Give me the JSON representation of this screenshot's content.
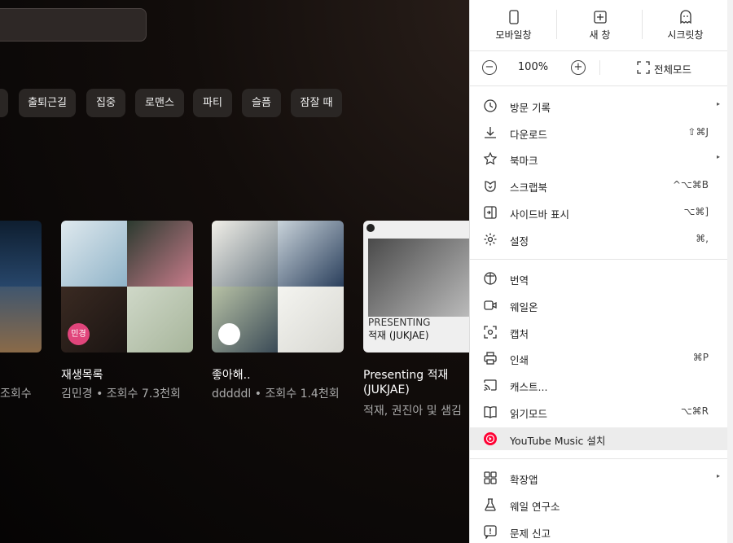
{
  "chips": [
    "출퇴근길",
    "집중",
    "로맨스",
    "파티",
    "슬픔",
    "잠잘 때"
  ],
  "cards": [
    {
      "title": "",
      "subtitle": "조회수"
    },
    {
      "title": "재생목록",
      "subtitle": "김민경 • 조회수 7.3천회",
      "badge": "민경"
    },
    {
      "title": "좋아해..",
      "subtitle": "dddddl • 조회수 1.4천회"
    },
    {
      "title_line1": "Presenting 적재",
      "title_line2": "(JUKJAE)",
      "subtitle": "적재, 권진아 및 샘김",
      "cover_line1": "PRESENTING",
      "cover_line2": "적재 (JUKJAE)"
    }
  ],
  "menu": {
    "top_buttons": [
      {
        "label": "모바일창",
        "icon": "mobile-icon"
      },
      {
        "label": "새 창",
        "icon": "new-window-icon"
      },
      {
        "label": "시크릿창",
        "icon": "incognito-icon"
      }
    ],
    "zoom": {
      "minus": "−",
      "value": "100%",
      "plus": "+",
      "fullscreen": "전체모드"
    },
    "items": [
      {
        "label": "방문 기록",
        "shortcut": "",
        "arrow": "▸",
        "icon": "clock-icon"
      },
      {
        "label": "다운로드",
        "shortcut": "⇧⌘J",
        "arrow": "",
        "icon": "download-icon"
      },
      {
        "label": "북마크",
        "shortcut": "",
        "arrow": "▸",
        "icon": "star-icon"
      },
      {
        "label": "스크랩북",
        "shortcut": "^⌥⌘B",
        "arrow": "",
        "icon": "scrapbook-icon"
      },
      {
        "label": "사이드바 표시",
        "shortcut": "⌥⌘]",
        "arrow": "",
        "icon": "sidebar-icon"
      },
      {
        "label": "설정",
        "shortcut": "⌘,",
        "arrow": "",
        "icon": "gear-icon"
      },
      {
        "label": "번역",
        "shortcut": "",
        "arrow": "",
        "icon": "translate-icon"
      },
      {
        "label": "웨일온",
        "shortcut": "",
        "arrow": "",
        "icon": "video-icon"
      },
      {
        "label": "캡처",
        "shortcut": "",
        "arrow": "",
        "icon": "capture-icon"
      },
      {
        "label": "인쇄",
        "shortcut": "⌘P",
        "arrow": "",
        "icon": "print-icon"
      },
      {
        "label": "캐스트...",
        "shortcut": "",
        "arrow": "",
        "icon": "cast-icon"
      },
      {
        "label": "읽기모드",
        "shortcut": "⌥⌘R",
        "arrow": "",
        "icon": "book-icon"
      },
      {
        "label": "YouTube Music 설치",
        "shortcut": "",
        "arrow": "",
        "icon": "youtube-music-icon"
      },
      {
        "label": "확장앱",
        "shortcut": "",
        "arrow": "▸",
        "icon": "extensions-icon"
      },
      {
        "label": "웨일 연구소",
        "shortcut": "",
        "arrow": "",
        "icon": "flask-icon"
      },
      {
        "label": "문제 신고",
        "shortcut": "",
        "arrow": "",
        "icon": "report-icon"
      }
    ]
  },
  "colors": {
    "accent_red": "#ff0033",
    "badge_pink": "#e0457b",
    "highlight": "#ececec"
  }
}
